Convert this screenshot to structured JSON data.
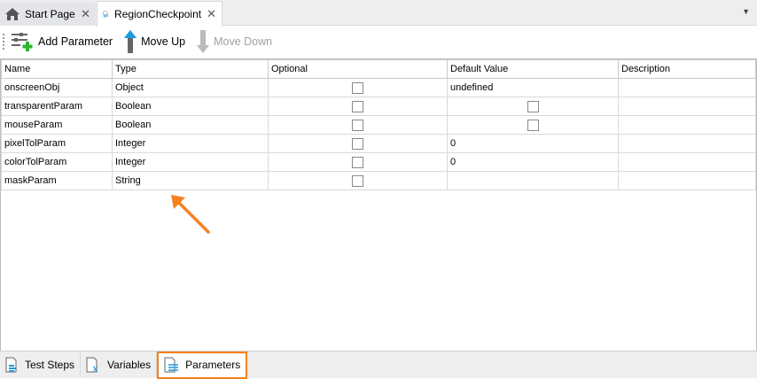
{
  "tabs": [
    {
      "label": "Start Page",
      "icon": "home-icon"
    },
    {
      "label": "RegionCheckpoint",
      "icon": "checkpoint-icon"
    }
  ],
  "toolbar": {
    "add": "Add Parameter",
    "up": "Move Up",
    "down": "Move Down"
  },
  "columns": [
    "Name",
    "Type",
    "Optional",
    "Default Value",
    "Description"
  ],
  "rows": [
    {
      "name": "onscreenObj",
      "type": "Object",
      "optional": false,
      "default": "undefined",
      "default_checkbox": false
    },
    {
      "name": "transparentParam",
      "type": "Boolean",
      "optional": false,
      "default": "",
      "default_checkbox": true
    },
    {
      "name": "mouseParam",
      "type": "Boolean",
      "optional": false,
      "default": "",
      "default_checkbox": true
    },
    {
      "name": "pixelTolParam",
      "type": "Integer",
      "optional": false,
      "default": "0",
      "default_checkbox": false
    },
    {
      "name": "colorTolParam",
      "type": "Integer",
      "optional": false,
      "default": "0",
      "default_checkbox": false
    },
    {
      "name": "maskParam",
      "type": "String",
      "optional": false,
      "default": "",
      "default_checkbox": false
    }
  ],
  "bottom_tabs": [
    {
      "label": "Test Steps"
    },
    {
      "label": "Variables"
    },
    {
      "label": "Parameters",
      "active": true
    }
  ],
  "colors": {
    "highlight": "#f5821f",
    "accent": "#1a9be0"
  }
}
